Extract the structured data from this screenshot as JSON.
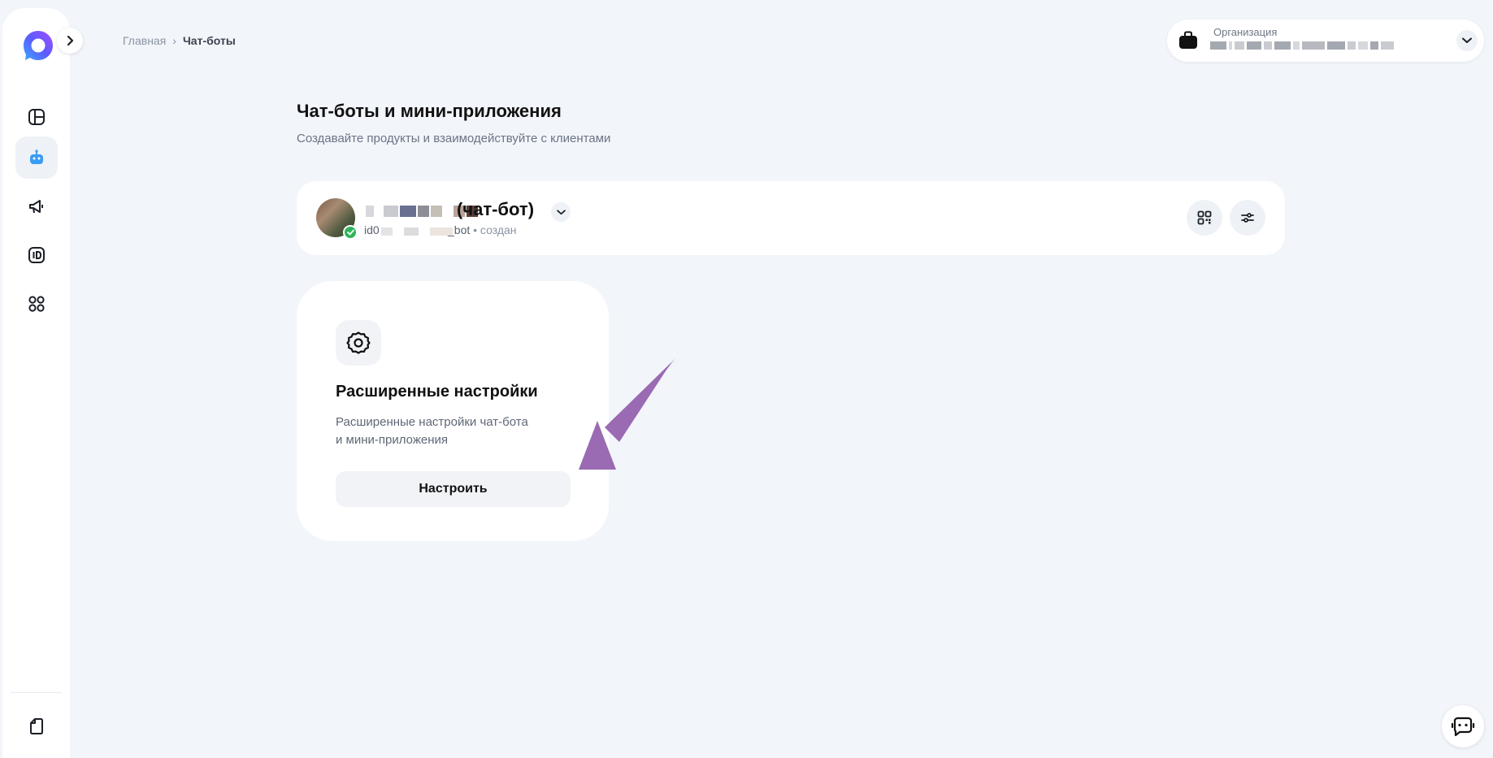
{
  "sidebar": {
    "items": [
      {
        "name": "dashboard",
        "icon": "dashboard-icon",
        "active": false
      },
      {
        "name": "chatbots",
        "icon": "robot-icon",
        "active": true
      },
      {
        "name": "campaigns",
        "icon": "megaphone-icon",
        "active": false
      },
      {
        "name": "id",
        "icon": "id-card-icon",
        "active": false
      },
      {
        "name": "apps",
        "icon": "apps-grid-icon",
        "active": false
      }
    ],
    "bottom_item": {
      "name": "documents",
      "icon": "document-icon"
    }
  },
  "breadcrumb": {
    "home": "Главная",
    "separator": "›",
    "current": "Чат-боты"
  },
  "organization": {
    "label": "Организация"
  },
  "page": {
    "title": "Чат-боты и мини-приложения",
    "subtitle": "Создавайте продукты и взаимодействуйте с клиентами"
  },
  "bot": {
    "name_suffix": "(чат-бот)",
    "id_prefix": "id0",
    "id_suffix": "_bot",
    "status": "• создан",
    "verified": true
  },
  "settings_card": {
    "title": "Расширенные настройки",
    "description_line1": "Расширенные настройки чат-бота",
    "description_line2": "и мини-приложения",
    "button_label": "Настроить"
  },
  "colors": {
    "background": "#f2f5fa",
    "card": "#ffffff",
    "accent_purple": "#9a6ab3",
    "verified_green": "#2fb45a"
  }
}
